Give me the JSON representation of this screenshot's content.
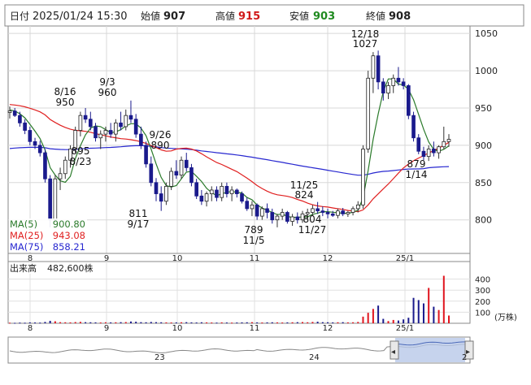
{
  "header": {
    "label_date": "日付",
    "date": "2025/01/24 15:30",
    "label_open": "始値",
    "open": "907",
    "label_high": "高値",
    "high": "915",
    "label_low": "安値",
    "low": "903",
    "label_close": "終値",
    "close": "908"
  },
  "colors": {
    "up": "#e0141e",
    "down": "#1a1a8c",
    "ma5": "#2a7a2a",
    "ma25": "#e02020",
    "ma75": "#2828d0",
    "volume_neutral": "#999999",
    "navigator_fill": "#b8c8e8"
  },
  "legend": [
    {
      "name": "MA(5)",
      "value": "900.80",
      "color": "#2a7a2a"
    },
    {
      "name": "MA(25)",
      "value": "943.08",
      "color": "#e02020"
    },
    {
      "name": "MA(75)",
      "value": "858.21",
      "color": "#2828d0"
    }
  ],
  "volume_panel": {
    "label": "出来高",
    "value": "482,600株",
    "unit": "(万株)",
    "ticks": [
      "400",
      "300",
      "200",
      "100"
    ]
  },
  "navigator": {
    "labels": [
      "23",
      "24",
      "2"
    ],
    "left_handle_icon": "chevron-left-icon",
    "right_handle_icon": "chevron-right-icon"
  },
  "chart_data": {
    "type": "candlestick",
    "ylim": [
      755,
      1060
    ],
    "yticks": [
      800,
      850,
      900,
      950,
      1000,
      1050
    ],
    "month_labels": [
      "8",
      "9",
      "10",
      "11",
      "12",
      "25/1"
    ],
    "volume_ylim": [
      0,
      500
    ],
    "volume_ticks": [
      100,
      200,
      300,
      400
    ],
    "annotations": [
      {
        "price": "950",
        "date": "8/16",
        "position": "above"
      },
      {
        "price": "960",
        "date": "9/3",
        "position": "above"
      },
      {
        "price": "895",
        "date": "8/23",
        "position": "below"
      },
      {
        "price": "890",
        "date": "9/26",
        "position": "above"
      },
      {
        "price": "811",
        "date": "9/17",
        "position": "below"
      },
      {
        "price": "824",
        "date": "11/25",
        "position": "above"
      },
      {
        "price": "789",
        "date": "11/5",
        "position": "below"
      },
      {
        "price": "804",
        "date": "11/27",
        "position": "below"
      },
      {
        "price": "1027",
        "date": "12/18",
        "position": "above"
      },
      {
        "price": "879",
        "date": "1/14",
        "position": "below"
      }
    ],
    "candles": [
      [
        944,
        952,
        936,
        946
      ],
      [
        946,
        950,
        938,
        940
      ],
      [
        940,
        945,
        925,
        930
      ],
      [
        930,
        935,
        915,
        920
      ],
      [
        920,
        925,
        900,
        905
      ],
      [
        905,
        910,
        895,
        900
      ],
      [
        900,
        906,
        885,
        890
      ],
      [
        890,
        895,
        850,
        855
      ],
      [
        855,
        860,
        790,
        800
      ],
      [
        800,
        860,
        795,
        855
      ],
      [
        855,
        870,
        840,
        862
      ],
      [
        862,
        885,
        855,
        880
      ],
      [
        880,
        900,
        870,
        895
      ],
      [
        895,
        925,
        890,
        920
      ],
      [
        920,
        945,
        912,
        940
      ],
      [
        940,
        950,
        930,
        935
      ],
      [
        935,
        945,
        920,
        925
      ],
      [
        925,
        930,
        905,
        910
      ],
      [
        910,
        920,
        895,
        915
      ],
      [
        915,
        925,
        905,
        920
      ],
      [
        920,
        930,
        910,
        915
      ],
      [
        915,
        935,
        905,
        930
      ],
      [
        930,
        945,
        920,
        925
      ],
      [
        925,
        948,
        920,
        940
      ],
      [
        940,
        960,
        930,
        935
      ],
      [
        935,
        942,
        910,
        915
      ],
      [
        915,
        925,
        895,
        900
      ],
      [
        900,
        905,
        870,
        875
      ],
      [
        875,
        885,
        845,
        850
      ],
      [
        850,
        856,
        825,
        835
      ],
      [
        835,
        845,
        812,
        825
      ],
      [
        825,
        850,
        820,
        845
      ],
      [
        845,
        870,
        840,
        865
      ],
      [
        865,
        880,
        855,
        860
      ],
      [
        860,
        885,
        855,
        880
      ],
      [
        880,
        890,
        865,
        870
      ],
      [
        870,
        875,
        845,
        850
      ],
      [
        850,
        855,
        828,
        832
      ],
      [
        832,
        840,
        820,
        825
      ],
      [
        825,
        838,
        818,
        835
      ],
      [
        835,
        845,
        825,
        840
      ],
      [
        840,
        845,
        825,
        830
      ],
      [
        830,
        850,
        825,
        845
      ],
      [
        845,
        850,
        830,
        835
      ],
      [
        835,
        845,
        825,
        840
      ],
      [
        840,
        842,
        830,
        835
      ],
      [
        835,
        838,
        822,
        825
      ],
      [
        825,
        830,
        812,
        815
      ],
      [
        815,
        825,
        805,
        820
      ],
      [
        820,
        822,
        800,
        805
      ],
      [
        805,
        818,
        800,
        815
      ],
      [
        815,
        822,
        802,
        810
      ],
      [
        810,
        815,
        795,
        800
      ],
      [
        800,
        808,
        790,
        805
      ],
      [
        805,
        815,
        800,
        810
      ],
      [
        810,
        812,
        795,
        798
      ],
      [
        798,
        808,
        792,
        804
      ],
      [
        804,
        810,
        795,
        800
      ],
      [
        800,
        812,
        796,
        808
      ],
      [
        808,
        815,
        800,
        810
      ],
      [
        810,
        820,
        805,
        815
      ],
      [
        815,
        824,
        808,
        812
      ],
      [
        812,
        818,
        805,
        810
      ],
      [
        810,
        815,
        802,
        808
      ],
      [
        808,
        812,
        804,
        806
      ],
      [
        806,
        815,
        802,
        812
      ],
      [
        812,
        816,
        805,
        808
      ],
      [
        808,
        812,
        804,
        810
      ],
      [
        810,
        818,
        806,
        815
      ],
      [
        815,
        825,
        810,
        820
      ],
      [
        820,
        900,
        815,
        895
      ],
      [
        895,
        1000,
        890,
        990
      ],
      [
        990,
        1025,
        970,
        1020
      ],
      [
        1020,
        1027,
        975,
        985
      ],
      [
        985,
        990,
        960,
        970
      ],
      [
        970,
        985,
        962,
        980
      ],
      [
        980,
        995,
        970,
        990
      ],
      [
        990,
        1005,
        980,
        985
      ],
      [
        985,
        990,
        975,
        980
      ],
      [
        980,
        982,
        935,
        940
      ],
      [
        940,
        945,
        905,
        910
      ],
      [
        910,
        915,
        888,
        892
      ],
      [
        892,
        898,
        880,
        885
      ],
      [
        885,
        900,
        879,
        895
      ],
      [
        895,
        905,
        885,
        890
      ],
      [
        890,
        900,
        882,
        898
      ],
      [
        898,
        925,
        895,
        905
      ],
      [
        905,
        915,
        898,
        908
      ]
    ],
    "volume": [
      5,
      4,
      6,
      5,
      8,
      7,
      6,
      12,
      22,
      18,
      10,
      9,
      8,
      11,
      13,
      10,
      9,
      8,
      7,
      9,
      8,
      9,
      10,
      11,
      16,
      14,
      10,
      9,
      12,
      10,
      9,
      8,
      7,
      8,
      9,
      10,
      8,
      7,
      9,
      8,
      7,
      6,
      8,
      7,
      6,
      7,
      8,
      9,
      10,
      8,
      7,
      8,
      9,
      8,
      7,
      8,
      9,
      10,
      11,
      9,
      12,
      14,
      10,
      9,
      8,
      9,
      10,
      8,
      9,
      12,
      60,
      95,
      130,
      160,
      40,
      20,
      30,
      25,
      35,
      50,
      230,
      210,
      180,
      320,
      150,
      120,
      430,
      70
    ]
  }
}
